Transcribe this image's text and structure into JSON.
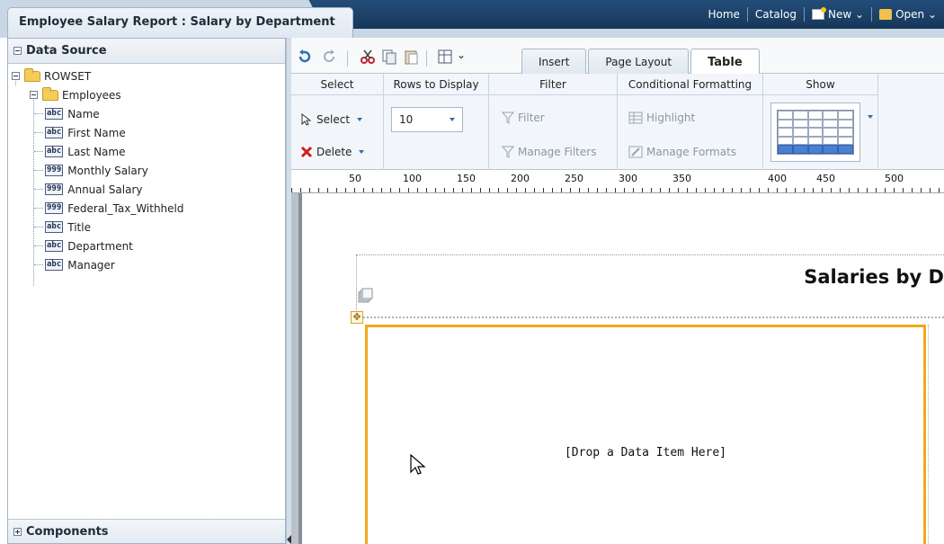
{
  "app": {
    "report_title": "Employee Salary Report : Salary by Department"
  },
  "global_nav": {
    "home": "Home",
    "catalog": "Catalog",
    "new": "New",
    "open": "Open"
  },
  "left_panel": {
    "header": "Data Source",
    "footer": "Components",
    "root": "ROWSET",
    "group": "Employees",
    "fields": [
      {
        "type": "abc",
        "label": "Name"
      },
      {
        "type": "abc",
        "label": "First Name"
      },
      {
        "type": "abc",
        "label": "Last Name"
      },
      {
        "type": "999",
        "label": "Monthly Salary"
      },
      {
        "type": "999",
        "label": "Annual Salary"
      },
      {
        "type": "999",
        "label": "Federal_Tax_Withheld"
      },
      {
        "type": "abc",
        "label": "Title"
      },
      {
        "type": "abc",
        "label": "Department"
      },
      {
        "type": "abc",
        "label": "Manager"
      }
    ]
  },
  "tabs": [
    {
      "label": "Insert",
      "active": false
    },
    {
      "label": "Page Layout",
      "active": false
    },
    {
      "label": "Table",
      "active": true
    }
  ],
  "ribbon": {
    "select": {
      "title": "Select",
      "select_label": "Select",
      "delete_label": "Delete"
    },
    "rows": {
      "title": "Rows to Display",
      "value": "10"
    },
    "filter": {
      "title": "Filter",
      "filter_label": "Filter",
      "manage_label": "Manage Filters"
    },
    "conditional": {
      "title": "Conditional Formatting",
      "highlight_label": "Highlight",
      "manage_label": "Manage Formats"
    },
    "show": {
      "title": "Show"
    }
  },
  "ruler": {
    "labels": [
      "50",
      "100",
      "150",
      "200",
      "250",
      "300",
      "350",
      "400",
      "450",
      "500"
    ]
  },
  "canvas": {
    "title": "Salaries by D",
    "drop_text": "[Drop a Data Item Here]"
  },
  "colors": {
    "nav_bg": "#1b3f66",
    "accent_orange": "#f2a818",
    "table_highlight": "#4a7fd3"
  }
}
